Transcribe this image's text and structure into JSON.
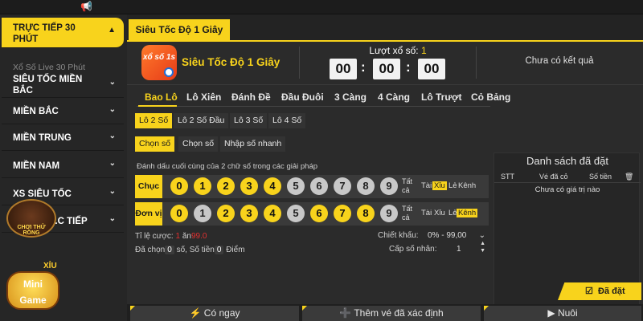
{
  "colors": {
    "accent": "#f8d31c",
    "background": "#2b2b2b",
    "sidebar": "#262626",
    "logo": "#ff7a2b",
    "danger": "#e23030"
  },
  "topbar": {
    "icon": "megaphone-icon"
  },
  "sidebar": {
    "active": "TRỰC TIẾP 30 PHÚT",
    "sub": "Xổ Số Live 30 Phút",
    "items": [
      "SIÊU TỐC MIỀN BẮC",
      "MIỀN BẮC",
      "MIỀN TRUNG",
      "MIỀN NAM",
      "XS SIÊU TỐC",
      "...C TIẾP"
    ]
  },
  "header": {
    "tab": "Siêu Tốc Độ 1 Giây"
  },
  "game": {
    "name": "Siêu Tốc Độ 1 Giây",
    "logo_text": "xổ số 1s",
    "draw_label": "Lượt xổ số:",
    "draw_number": "1",
    "countdown": [
      "00",
      "00",
      "00"
    ],
    "result": "Chưa có kết quả"
  },
  "tabs": [
    "Bao Lô",
    "Lô Xiên",
    "Đánh Đề",
    "Đầu Đuôi",
    "3 Càng",
    "4 Càng",
    "Lô Trượt",
    "Cỏ Bảng"
  ],
  "subtabs": [
    "Lô 2 Số",
    "Lô 2 Số Đầu",
    "Lô 3 Số",
    "Lô 4 Số"
  ],
  "modes": [
    "Chọn số",
    "Chọn số",
    "Nhập số nhanh"
  ],
  "hint": "Đánh dấu cuối cùng của 2 chữ số trong các giải pháp",
  "rows": [
    {
      "label": "Chục",
      "balls": [
        "0",
        "1",
        "2",
        "3",
        "4",
        "5",
        "6",
        "7",
        "8",
        "9"
      ],
      "active": [
        true,
        true,
        true,
        true,
        true,
        false,
        false,
        false,
        false,
        false
      ],
      "all": "Tất cả",
      "opts": [
        "Tài",
        "Xỉu",
        "Lẻ",
        "Kênh"
      ],
      "opt_on": 1
    },
    {
      "label": "Đơn vị",
      "balls": [
        "0",
        "1",
        "2",
        "3",
        "4",
        "5",
        "6",
        "7",
        "8",
        "9"
      ],
      "active": [
        true,
        false,
        true,
        true,
        true,
        false,
        true,
        true,
        true,
        false
      ],
      "all": "Tất cả",
      "opts": [
        "Tài",
        "Xỉu",
        "Lẻ",
        "Kênh"
      ],
      "opt_on": 3
    }
  ],
  "bet": {
    "rate_label": "Tỉ lệ cược:",
    "rate_a": "1",
    "rate_mid": "ăn",
    "rate_b": "99.0",
    "chosen_a": "Đã chọn",
    "chosen_n": "0",
    "chosen_b": "số, Số tiền",
    "money_n": "0",
    "money_c": "Điểm",
    "discount_label": "Chiết khấu:",
    "discount_value": "0% - 99,00",
    "multiplier_label": "Cấp số nhân:",
    "multiplier_value": "1"
  },
  "panel": {
    "title": "Danh sách đã đặt",
    "cols": [
      "STT",
      "Vé đã cỏ",
      "Số tiền"
    ],
    "empty": "Chưa có giá trị nào",
    "button": "Đã đặt"
  },
  "buttons": {
    "now": "Có ngay",
    "add": "Thêm vé đã xác định",
    "nuoi": "Nuôi"
  },
  "promo": {
    "chip": "CHƠI THỬ RỒNG",
    "mini_top": "XỈU",
    "mini_a": "Mini",
    "mini_b": "Game"
  }
}
